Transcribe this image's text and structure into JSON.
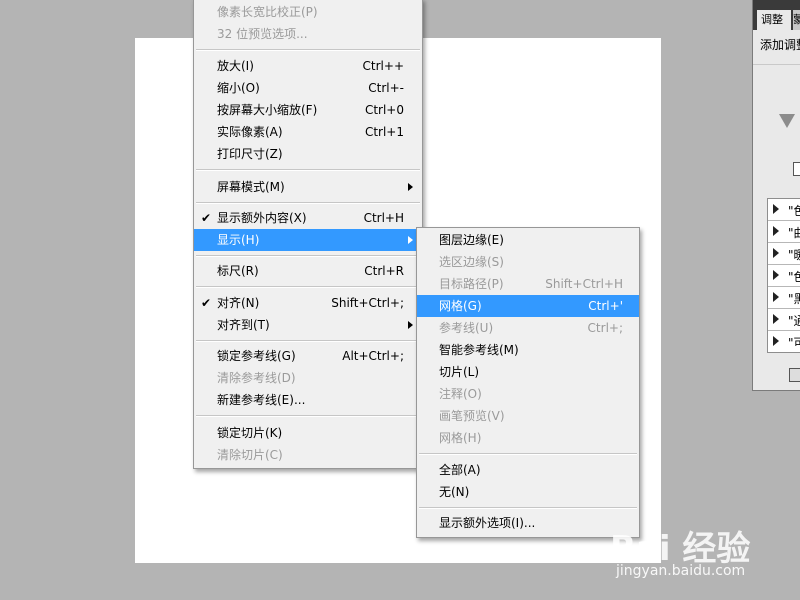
{
  "main_menu": {
    "items": [
      {
        "label": "像素长宽比校正(P)",
        "shortcut": "",
        "disabled": true
      },
      {
        "label": "32 位预览选项...",
        "shortcut": "",
        "disabled": true
      },
      {
        "label": "放大(I)",
        "shortcut": "Ctrl++"
      },
      {
        "label": "缩小(O)",
        "shortcut": "Ctrl+-"
      },
      {
        "label": "按屏幕大小缩放(F)",
        "shortcut": "Ctrl+0"
      },
      {
        "label": "实际像素(A)",
        "shortcut": "Ctrl+1"
      },
      {
        "label": "打印尺寸(Z)",
        "shortcut": ""
      },
      {
        "label": "屏幕模式(M)",
        "shortcut": "",
        "submenu": true
      },
      {
        "label": "显示额外内容(X)",
        "shortcut": "Ctrl+H",
        "checked": true
      },
      {
        "label": "显示(H)",
        "shortcut": "",
        "submenu": true,
        "highlighted": true
      },
      {
        "label": "标尺(R)",
        "shortcut": "Ctrl+R"
      },
      {
        "label": "对齐(N)",
        "shortcut": "Shift+Ctrl+;",
        "checked": true
      },
      {
        "label": "对齐到(T)",
        "shortcut": "",
        "submenu": true
      },
      {
        "label": "锁定参考线(G)",
        "shortcut": "Alt+Ctrl+;"
      },
      {
        "label": "清除参考线(D)",
        "shortcut": "",
        "disabled": true
      },
      {
        "label": "新建参考线(E)...",
        "shortcut": ""
      },
      {
        "label": "锁定切片(K)",
        "shortcut": ""
      },
      {
        "label": "清除切片(C)",
        "shortcut": "",
        "disabled": true
      }
    ]
  },
  "show_submenu": {
    "items": [
      {
        "label": "图层边缘(E)",
        "shortcut": ""
      },
      {
        "label": "选区边缘(S)",
        "shortcut": "",
        "disabled": true
      },
      {
        "label": "目标路径(P)",
        "shortcut": "Shift+Ctrl+H",
        "disabled": true
      },
      {
        "label": "网格(G)",
        "shortcut": "Ctrl+'",
        "highlighted": true
      },
      {
        "label": "参考线(U)",
        "shortcut": "Ctrl+;",
        "disabled": true
      },
      {
        "label": "智能参考线(M)",
        "shortcut": ""
      },
      {
        "label": "切片(L)",
        "shortcut": ""
      },
      {
        "label": "注释(O)",
        "shortcut": "",
        "disabled": true
      },
      {
        "label": "画笔预览(V)",
        "shortcut": "",
        "disabled": true
      },
      {
        "label": "网格(H)",
        "shortcut": "",
        "disabled": true
      },
      {
        "label": "全部(A)",
        "shortcut": ""
      },
      {
        "label": "无(N)",
        "shortcut": ""
      },
      {
        "label": "显示额外选项(I)...",
        "shortcut": ""
      }
    ]
  },
  "panel": {
    "tab_active": "调整",
    "tab_second": "蒙",
    "title": "添加调整",
    "presets": [
      "\"色",
      "\"曲",
      "\"暖",
      "\"色",
      "\"黑",
      "\"通",
      "\"可"
    ]
  },
  "watermark": {
    "brand": "Bai 经验",
    "url": "jingyan.baidu.com"
  },
  "colors": {
    "highlight": "#3399ff",
    "menu_bg": "#f0f0f0",
    "workspace": "#b4b4b4"
  }
}
